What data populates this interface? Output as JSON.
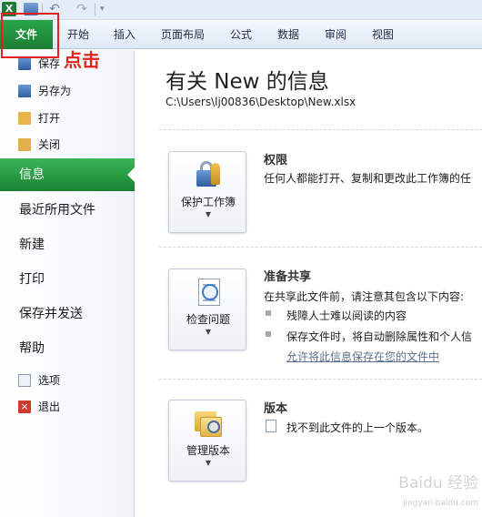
{
  "quick_access": {
    "app_icon": "excel-icon",
    "icons": [
      "save-icon",
      "undo-icon",
      "redo-icon"
    ]
  },
  "ribbon": {
    "tabs": [
      "文件",
      "开始",
      "插入",
      "页面布局",
      "公式",
      "数据",
      "审阅",
      "视图"
    ]
  },
  "callout": {
    "text": "点击",
    "color": "#e3231b"
  },
  "nav": {
    "items": [
      {
        "label": "保存",
        "icon": "save-icon"
      },
      {
        "label": "另存为",
        "icon": "save-as-icon"
      },
      {
        "label": "打开",
        "icon": "folder-open-icon"
      },
      {
        "label": "关闭",
        "icon": "folder-close-icon"
      },
      {
        "label": "信息"
      },
      {
        "label": "最近所用文件"
      },
      {
        "label": "新建"
      },
      {
        "label": "打印"
      },
      {
        "label": "保存并发送"
      },
      {
        "label": "帮助"
      },
      {
        "label": "选项",
        "icon": "options-icon"
      },
      {
        "label": "退出",
        "icon": "exit-icon"
      }
    ],
    "active_color": "#1f8a3b"
  },
  "info": {
    "title": "有关 New 的信息",
    "path": "C:\\Users\\lj00836\\Desktop\\New.xlsx",
    "permissions": {
      "button": "保护工作簿",
      "title": "权限",
      "text": "任何人都能打开、复制和更改此工作簿的任"
    },
    "prepare": {
      "button": "检查问题",
      "title": "准备共享",
      "text": "在共享此文件前，请注意其包含以下内容:",
      "bullets": [
        "残障人士难以阅读的内容",
        "保存文件时，将自动删除属性和个人信"
      ],
      "link": "允许将此信息保存在您的文件中"
    },
    "versions": {
      "button": "管理版本",
      "title": "版本",
      "text": "找不到此文件的上一个版本。"
    }
  },
  "watermark": {
    "text": "Baidu 经验",
    "sub": "jingyan.baidu.com"
  }
}
